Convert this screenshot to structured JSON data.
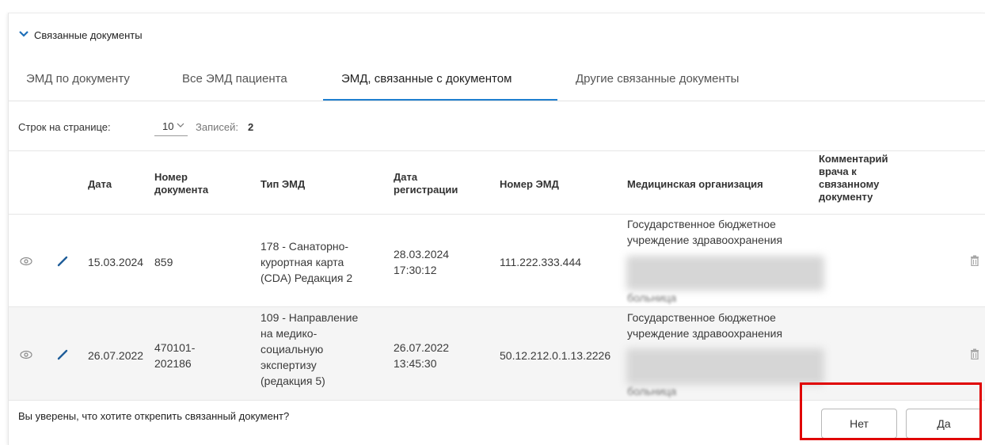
{
  "section": {
    "title": "Связанные документы",
    "icon": "chevron-down-icon"
  },
  "tabs": [
    {
      "label": "ЭМД по документу",
      "active": false
    },
    {
      "label": "Все ЭМД пациента",
      "active": false
    },
    {
      "label": "ЭМД, связанные с документом",
      "active": true
    },
    {
      "label": "Другие связанные документы",
      "active": false
    }
  ],
  "pagination": {
    "rows_label": "Строк на странице:",
    "rows_value": "10",
    "records_label": "Записей:",
    "records_value": "2"
  },
  "table": {
    "headers": {
      "date": "Дата",
      "doc_number": [
        "Номер",
        "документа"
      ],
      "emd_type": "Тип ЭМД",
      "reg_date": [
        "Дата",
        "регистрации"
      ],
      "emd_number": "Номер ЭМД",
      "organization": "Медицинская организация",
      "comment": [
        "Комментарий",
        "врача к",
        "связанному",
        "документу"
      ]
    },
    "rows": [
      {
        "date": "15.03.2024",
        "doc_number": [
          "859"
        ],
        "emd_type": [
          "178 - Санаторно-",
          "курортная карта",
          "(CDA) Редакция 2"
        ],
        "reg_date": [
          "28.03.2024",
          "17:30:12"
        ],
        "emd_number": "111.222.333.444",
        "organization": [
          "Государственное бюджетное",
          "учреждение здравоохранения"
        ],
        "organization_tail": "больница"
      },
      {
        "date": "26.07.2022",
        "doc_number": [
          "470101-",
          "202186"
        ],
        "emd_type": [
          "109 - Направление",
          "на медико-",
          "социальную",
          "экспертизу",
          "(редакция 5)"
        ],
        "reg_date": [
          "26.07.2022",
          "13:45:30"
        ],
        "emd_number": "50.12.212.0.1.13.2226",
        "organization": [
          "Государственное бюджетное",
          "учреждение здравоохранения"
        ],
        "organization_tail": "больница"
      }
    ]
  },
  "confirm": {
    "question": "Вы уверены, что хотите открепить связанный документ?",
    "no_label": "Нет",
    "yes_label": "Да"
  },
  "colors": {
    "accent": "#1e7fcf",
    "highlight": "#e00000"
  }
}
